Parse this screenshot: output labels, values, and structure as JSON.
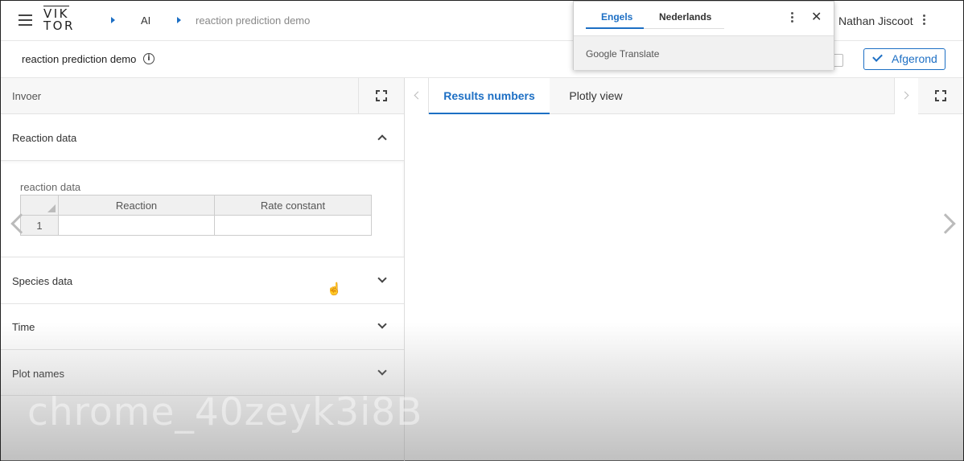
{
  "header": {
    "logo_top": "VIK",
    "logo_bottom": "TOR",
    "breadcrumbs": [
      "AI",
      "reaction prediction demo"
    ],
    "user": "Nathan Jiscoot"
  },
  "subheader": {
    "title": "reaction prediction demo",
    "done_label": "Afgerond"
  },
  "left": {
    "panel_title": "Invoer",
    "sections": [
      {
        "label": "Reaction data",
        "expanded": true
      },
      {
        "label": "Species data"
      },
      {
        "label": "Time"
      },
      {
        "label": "Plot names"
      }
    ],
    "table": {
      "label": "reaction data",
      "columns": [
        "Reaction",
        "Rate constant"
      ],
      "rows": [
        [
          "1",
          "",
          ""
        ]
      ]
    }
  },
  "right": {
    "tabs": [
      "Results numbers",
      "Plotly view"
    ]
  },
  "translate": {
    "tabs": [
      "Engels",
      "Nederlands"
    ],
    "brand": "Google Translate",
    "close": "✕"
  },
  "watermark": "chrome_40zeyk3i8B",
  "colors": {
    "accent": "#1d6fc4"
  }
}
